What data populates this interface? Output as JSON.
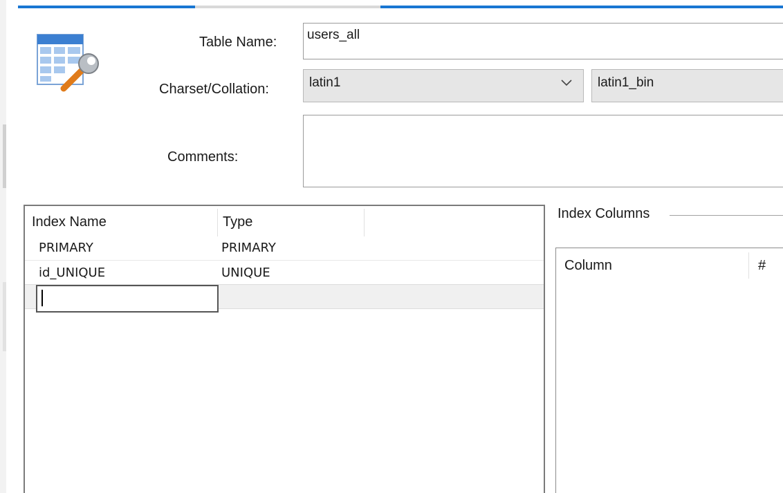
{
  "form": {
    "table_name_label": "Table Name:",
    "table_name_value": "users_all",
    "charset_label": "Charset/Collation:",
    "charset_value": "latin1",
    "collation_value": "latin1_bin",
    "comments_label": "Comments:",
    "comments_value": ""
  },
  "icons": {
    "table_icon": "table-wrench-icon",
    "dropdown_icon": "chevron-down-icon"
  },
  "indexes": {
    "headers": [
      "Index Name",
      "Type"
    ],
    "rows": [
      {
        "name": "PRIMARY",
        "type": "PRIMARY"
      },
      {
        "name": "id_UNIQUE",
        "type": "UNIQUE"
      }
    ],
    "new_row_value": ""
  },
  "index_columns": {
    "group_label": "Index Columns",
    "headers": [
      "Column",
      "#"
    ]
  },
  "colors": {
    "accent": "#1976d2"
  }
}
